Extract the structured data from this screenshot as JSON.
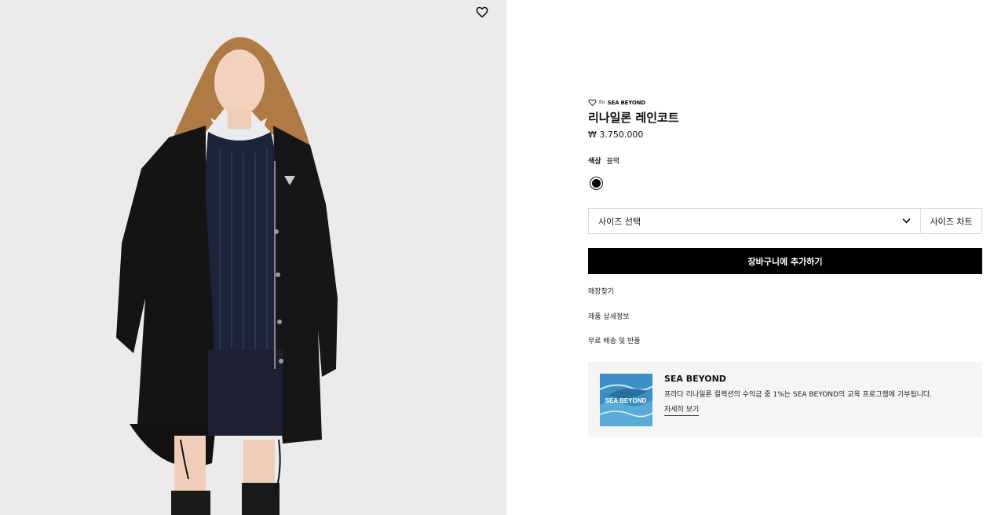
{
  "product": {
    "partner_for": "for",
    "partner_name": "SEA BEYOND",
    "title": "리나일론 레인코트",
    "price": "₩ 3.750.000",
    "color_label": "색상",
    "color_value": "블랙",
    "swatches": [
      {
        "name": "black",
        "color": "#000000",
        "selected": true
      }
    ]
  },
  "size": {
    "select_label": "사이즈 선택",
    "chart_label": "사이즈 차트"
  },
  "cart": {
    "add_label": "장바구니에 추가하기"
  },
  "links": {
    "store": "매장찾기",
    "details": "제품 상세정보",
    "shipping": "무료 배송 및 반품"
  },
  "sea_beyond": {
    "title": "SEA BEYOND",
    "description": "프라다 리나일론 컬렉션의 수익금 중 1%는 SEA BEYOND의 교육 프로그램에 기부됩니다.",
    "link_label": "자세히 보기",
    "thumb_text": "SEA BEYOND"
  },
  "icons": {
    "wishlist": "heart-outline-icon",
    "dropdown": "chevron-down-icon",
    "partner_logo": "heart-logo-icon"
  },
  "colors": {
    "image_bg": "#ebebeb",
    "button_bg": "#000000",
    "panel_bg": "#f5f5f5",
    "sea_blue": "#3b8fc4"
  }
}
